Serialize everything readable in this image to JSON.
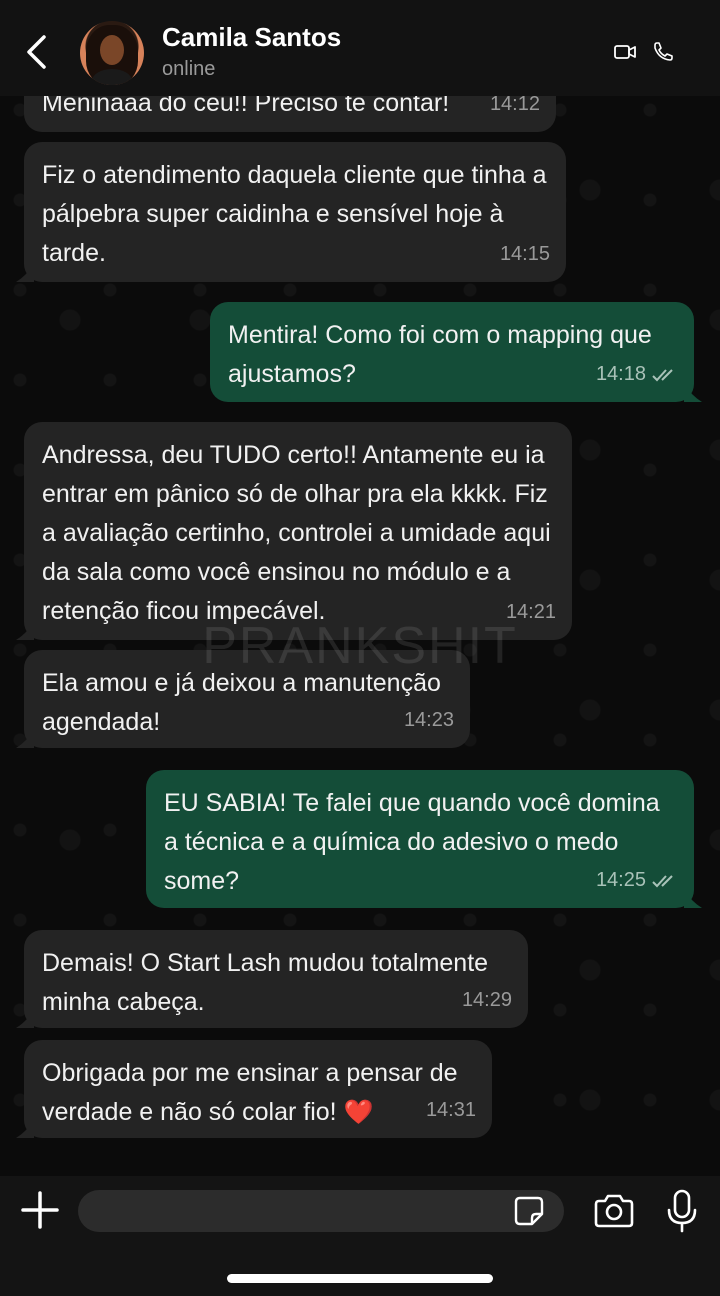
{
  "header": {
    "contact_name": "Camila Santos",
    "status": "online"
  },
  "watermark": "PRANKSHIT",
  "messages": [
    {
      "dir": "in",
      "text": "Meninaaa do céu!! Preciso te contar!",
      "time": "14:12"
    },
    {
      "dir": "in",
      "text": "Fiz o atendimento daquela cliente que tinha a pálpebra super caidinha e sensível hoje à tarde.",
      "time": "14:15"
    },
    {
      "dir": "out",
      "text": "Mentira! Como foi com o mapping que ajustamos?",
      "time": "14:18"
    },
    {
      "dir": "in",
      "text": "Andressa, deu TUDO certo!! Antamente eu ia entrar em pânico só de olhar pra ela kkkk. Fiz a avaliação certinho, controlei a umidade aqui da sala como você ensinou no módulo e a retenção ficou impecável.",
      "time": "14:21"
    },
    {
      "dir": "in",
      "text": "Ela amou e já deixou a manutenção agendada!",
      "time": "14:23"
    },
    {
      "dir": "out",
      "text": "EU SABIA! Te falei que quando você domina a técnica e a química do adesivo o medo some?",
      "time": "14:25"
    },
    {
      "dir": "in",
      "text": "Demais! O Start Lash mudou totalmente minha cabeça.",
      "time": "14:29"
    },
    {
      "dir": "in",
      "text": "Obrigada por me ensinar a pensar de verdade e não só colar fio!",
      "emoji": "❤️",
      "time": "14:31"
    }
  ],
  "colors": {
    "incoming_bubble": "#242424",
    "outgoing_bubble": "#144d38",
    "background": "#0b0b0b"
  },
  "icons": [
    "back-arrow-icon",
    "video-call-icon",
    "phone-icon",
    "plus-icon",
    "sticker-icon",
    "camera-icon",
    "mic-icon",
    "double-check-icon"
  ]
}
